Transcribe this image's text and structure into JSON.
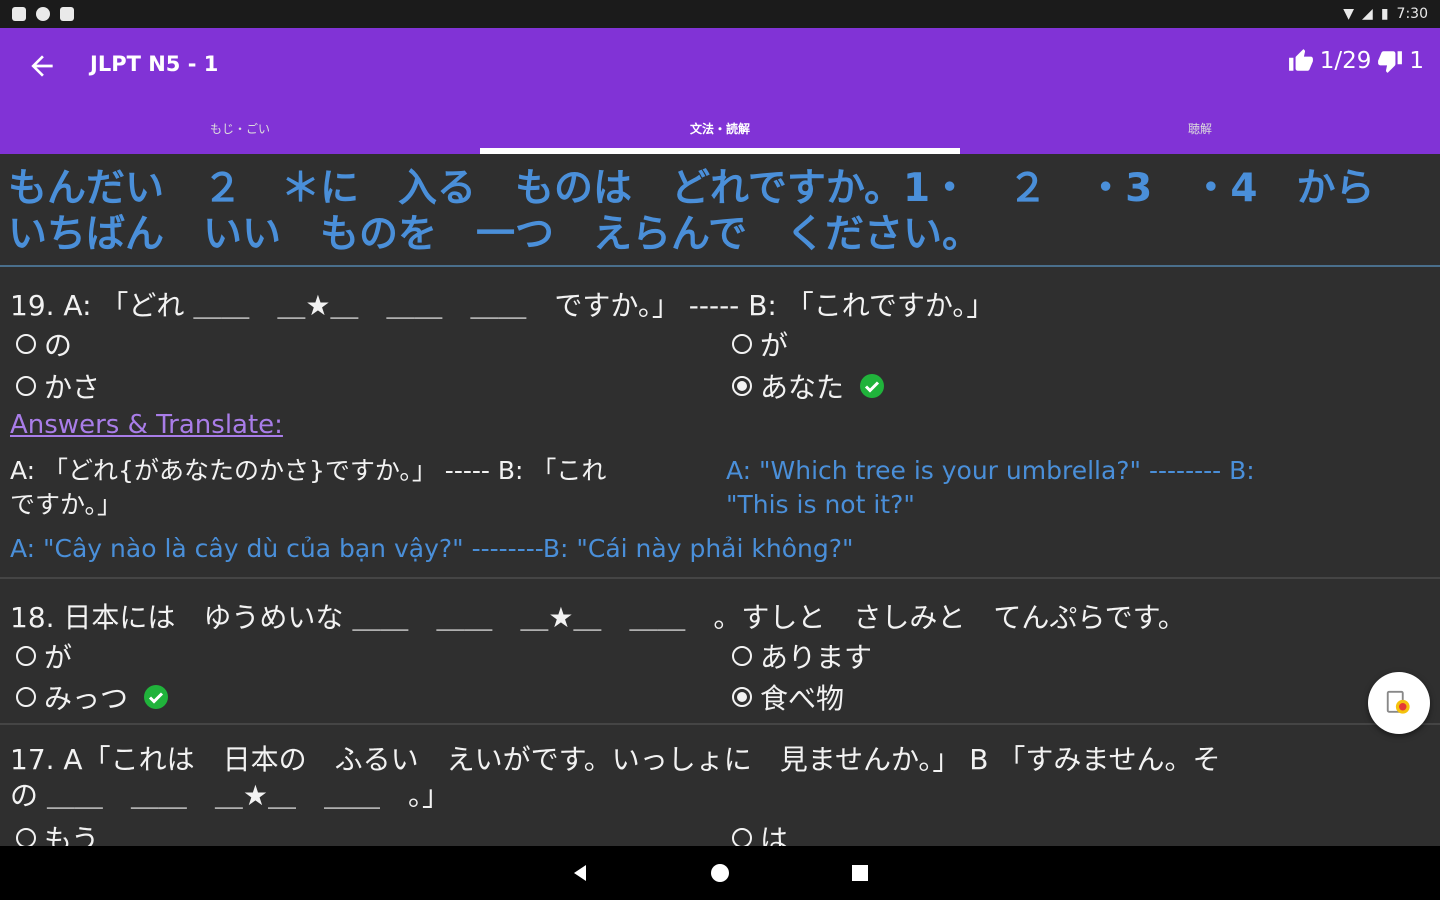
{
  "status": {
    "time": "7:30"
  },
  "appbar": {
    "title": "JLPT N5 - 1",
    "likes": "1/29",
    "dislikes": "1"
  },
  "tabs": [
    {
      "label": "もじ・ごい"
    },
    {
      "label": "文法・読解"
    },
    {
      "label": "聴解"
    }
  ],
  "instruction": "もんだい　２　＊に　入る　ものは　どれですか。1・　２　・3　・4　から　いちばん　いい　ものを　一つ　えらんで　ください。",
  "questions": [
    {
      "text": "19. A: 「どれ ＿＿　＿★＿　＿＿　＿＿　ですか。」 ----- B: 「これですか。」",
      "options": [
        "の",
        "が",
        "かさ",
        "あなた"
      ],
      "answers_title": "Answers & Translate:",
      "answer_jp": "A: 「どれ{があなたのかさ}ですか。」 ----- B: 「これですか。」",
      "answer_en": "A: \"Which tree is your umbrella?\" -------- B: \"This is not it?\"",
      "answer_vi": "A: \"Cây nào là cây dù của bạn vậy?\" --------B: \"Cái này phải không?\""
    },
    {
      "text": "18. 日本には　ゆうめいな ＿＿　＿＿　＿★＿　＿＿　。すしと　さしみと　てんぷらです。",
      "options": [
        "が",
        "あります",
        "みっつ",
        "食べ物"
      ]
    },
    {
      "text": "17. A「これは　日本の　ふるい　えいがです。いっしょに　見ませんか。」 B 「すみません。その ＿＿　＿＿　＿★＿　＿＿　。」",
      "options": [
        "もう",
        "は"
      ]
    }
  ],
  "colors": {
    "appbar": "#8133d6",
    "instruction": "#4a8fd9",
    "link": "#a97de8",
    "check": "#20b33b"
  }
}
